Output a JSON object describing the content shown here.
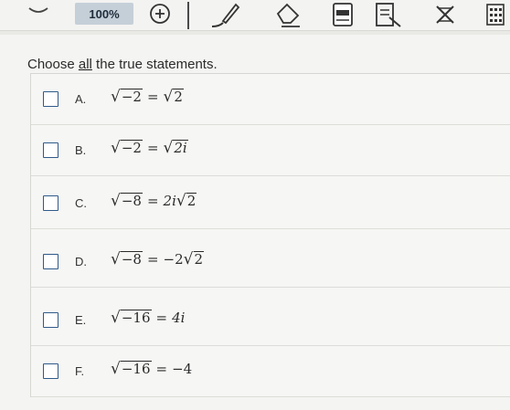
{
  "toolbar": {
    "zoom_value": "100%",
    "icons": [
      "search-icon",
      "zoom-in-icon",
      "pen-icon",
      "eraser-icon",
      "calculator-icon",
      "notes-icon",
      "cross-out-icon",
      "grid-icon"
    ]
  },
  "question": {
    "prompt_before": "Choose ",
    "prompt_all": "all",
    "prompt_after": " the true statements."
  },
  "options": [
    {
      "letter": "A.",
      "lhs_radicand": "−2",
      "rhs_coef": "",
      "rhs_radicand": "2",
      "rhs_plain": ""
    },
    {
      "letter": "B.",
      "lhs_radicand": "−2",
      "rhs_coef": "",
      "rhs_radicand": "2i",
      "rhs_plain": ""
    },
    {
      "letter": "C.",
      "lhs_radicand": "−8",
      "rhs_coef": "2i",
      "rhs_radicand": "2",
      "rhs_plain": ""
    },
    {
      "letter": "D.",
      "lhs_radicand": "−8",
      "rhs_coef": "−2",
      "rhs_radicand": "2",
      "rhs_plain": ""
    },
    {
      "letter": "E.",
      "lhs_radicand": "−16",
      "rhs_coef": "",
      "rhs_radicand": "",
      "rhs_plain": "4i"
    },
    {
      "letter": "F.",
      "lhs_radicand": "−16",
      "rhs_coef": "",
      "rhs_radicand": "",
      "rhs_plain": "−4"
    }
  ],
  "colors": {
    "checkbox_border": "#2f5a8a",
    "zoom_bg": "#c5cfd8",
    "bg": "#f4f4f2"
  }
}
